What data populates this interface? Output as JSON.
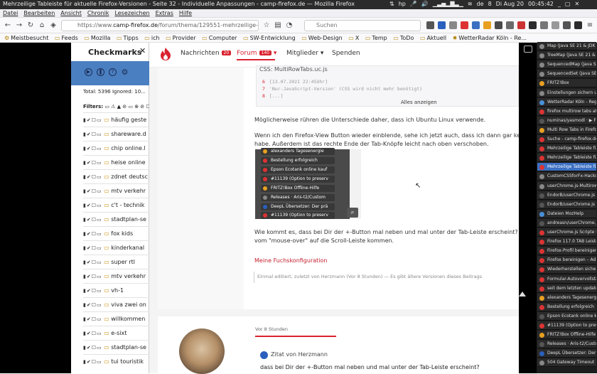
{
  "window": {
    "title": "Mehrzeilige Tableiste für aktuelle Firefox-Versionen - Seite 32 - Individuelle Anpassungen - camp-firefox.de — Mozilla Firefox",
    "clock": "Di Aug 20",
    "time": "00:45:42",
    "lang": "de",
    "battery": "8"
  },
  "menu": [
    "Datei",
    "Bearbeiten",
    "Ansicht",
    "Chronik",
    "Lesezeichen",
    "Extras",
    "Hilfe"
  ],
  "urlbar": {
    "prefix": "https://www.",
    "domain": "camp-firefox.de",
    "path": "/forum/thema/129551-mehrzeilige-tableiste",
    "search_placeholder": "Suchen"
  },
  "bookmarks": [
    "Meistbesucht",
    "Feeds",
    "Mozilla",
    "Tipps",
    "ich",
    "Provider",
    "Computer",
    "SW-Entwicklung",
    "Web-Design",
    "X",
    "Temp",
    "ToDo",
    "Aktuell",
    "WetterRadar Köln - Re..."
  ],
  "sidebar": {
    "title": "Checkmarks",
    "stats": "Total: 5396 Ignored: 10...",
    "filter": "Filters:",
    "items": [
      "häufig geste",
      "shareware.d",
      "chip online.l",
      "heise online",
      "zdnet deutsc",
      "mtv verkehr",
      "c't - technik",
      "stadtplan-se",
      "fox kids",
      "kinderkanal",
      "super rtl",
      "mtv verkehr",
      "vh-1",
      "viva zwei on",
      "willkommen",
      "e-sixt",
      "stadtplan-se",
      "tui touristik"
    ]
  },
  "site": {
    "nav": {
      "news": "Nachrichten",
      "news_count": "20",
      "forum": "Forum",
      "forum_count": "140",
      "members": "Mitglieder",
      "donate": "Spenden"
    }
  },
  "post": {
    "code_title": "CSS: MultiRowTabs.uc.js",
    "code_lines": [
      {
        "n": "6",
        "t": "[13.07.2021 22:45Uhr]"
      },
      {
        "n": "7",
        "t": "'Nur-JavaScript-Version' (CSS wird nicht mehr benötigt)"
      },
      {
        "n": "8",
        "t": "[...]"
      }
    ],
    "show_all": "Alles anzeigen",
    "p1": "Möglicherweise rühren die Unterschiede daher, dass ich Ubuntu Linux verwende.",
    "p2a": "Wenn ich den Firefox-View Button wieder einblende, sehe ich jetzt auch, dass ich dann gar keine",
    "p2b": "habe. Außerdem ist das rechte Ende der Tab-Knöpfe leicht nach oben verschoben.",
    "shot_tabs": [
      "alexanders Tagesenergie",
      "Bestellung erfolgreich",
      "Epson Ecotank online kauf",
      "#11139 (Option to preserv",
      "FRITZ!Box Offline-Hilfe",
      "Releases · Aris-t2/Custom",
      "DeepL Übersetzer: Der prä",
      "#11139 (Option to preserv"
    ],
    "p3a": "Wie kommt es, dass bei Dir der +-Button mal neben und mal unter der Tab-Leiste erscheint? Ka",
    "p3b": "vom \"mouse-over\" auf die Scroll-Leiste kommen.",
    "signature": "Meine Fuchskonfiguration",
    "edited": "Einmal editiert, zuletzt von Herzmann (Vor 8 Stunden) — Es gibt ältere Versionen dieses Beitrags"
  },
  "post2": {
    "time": "Vor 8 Stunden",
    "quote_title": "Zitat von Herzmann",
    "quote_text": "dass bei Dir der +-Button mal neben und mal unter der Tab-Leiste erscheint?"
  },
  "tabs": [
    {
      "t": "Map (Java SE 21 & JDK 21)",
      "c": "#888"
    },
    {
      "t": "TreeMap (Java SE 21 & JD",
      "c": "#888"
    },
    {
      "t": "SequencedMap (Java SE 21",
      "c": "#888"
    },
    {
      "t": "SequencedSet (Java SE 21",
      "c": "#888"
    },
    {
      "t": "FRITZ!Box",
      "c": "#e8a020"
    },
    {
      "t": "Einstellungen sichern u",
      "c": "#888"
    },
    {
      "t": "WetterRadar Köln - Rege",
      "c": "#4a90d9"
    },
    {
      "t": "firefox multirow tabs at C",
      "c": "#d33"
    },
    {
      "t": "numinas/yasmodl · ▶ F1",
      "c": "#555"
    },
    {
      "t": "Multi Row Tabs in Firefox",
      "c": "#e8a020"
    },
    {
      "t": "Suche - camp-firefox.de",
      "c": "#d33"
    },
    {
      "t": "Mehrzeilige Tableiste für",
      "c": "#d33"
    },
    {
      "t": "Mehrzeilige Tableiste für",
      "c": "#d33"
    },
    {
      "t": "Mehrzeilige Tableiste für",
      "c": "#d33"
    },
    {
      "t": "CustomCSSforFx-Hacks",
      "c": "#888"
    },
    {
      "t": "userChrome.js-Multirow",
      "c": "#888"
    },
    {
      "t": "EndorB/userChrome.js",
      "c": "#555"
    },
    {
      "t": "EndorB/userChrome.js",
      "c": "#555"
    },
    {
      "t": "Dateien MozHelp",
      "c": "#4a90d9"
    },
    {
      "t": "andreasn/userChrome.js",
      "c": "#555"
    },
    {
      "t": "userChrome.js Scripte fü",
      "c": "#d33"
    },
    {
      "t": "Firefox 117.0 TAB Leisten",
      "c": "#d33"
    },
    {
      "t": "Firefox-Profil bereinigen",
      "c": "#d33"
    },
    {
      "t": "Firefox bereinigen – Ad",
      "c": "#d33"
    },
    {
      "t": "Wiederherstellen sicher",
      "c": "#d33"
    },
    {
      "t": "Formular-Autovervollstän",
      "c": "#d33"
    },
    {
      "t": "seit dem letzten update",
      "c": "#d33"
    },
    {
      "t": "alexanders Tagesenergie",
      "c": "#e8a020"
    },
    {
      "t": "Bestellung erfolgreich",
      "c": "#d33"
    },
    {
      "t": "Epson Ecotank online kau",
      "c": "#555"
    },
    {
      "t": "#11139 (Option to preserv",
      "c": "#d33"
    },
    {
      "t": "FRITZ!Box Offline-Hilfe",
      "c": "#e8a020"
    },
    {
      "t": "Releases · Aris-t2/Custo",
      "c": "#555"
    },
    {
      "t": "DeepL Übersetzer: Der pr",
      "c": "#2a5fbd"
    },
    {
      "t": "504 Gateway Timeout",
      "c": "#888"
    }
  ],
  "selected_tab": 13
}
